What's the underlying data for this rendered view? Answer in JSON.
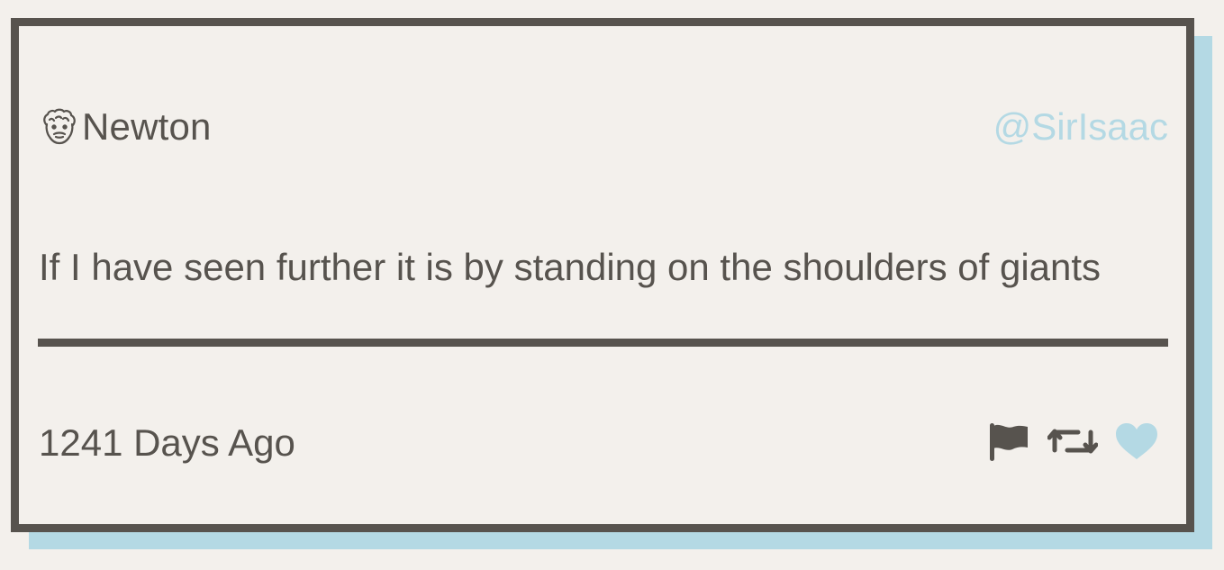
{
  "tweet": {
    "author_name": "Newton",
    "handle": "@SirIsaac",
    "text": "If I have seen further it is by standing on the shoulders of giants",
    "timestamp": "1241 Days Ago",
    "avatar_icon": "bearded-face-icon"
  },
  "actions": [
    {
      "icon": "flag-icon",
      "label": "Report"
    },
    {
      "icon": "retweet-icon",
      "label": "Retweet"
    },
    {
      "icon": "heart-icon",
      "label": "Like"
    }
  ],
  "colors": {
    "background": "#f3f0ec",
    "border": "#57534e",
    "text": "#57534e",
    "accent": "#b4d9e4"
  }
}
